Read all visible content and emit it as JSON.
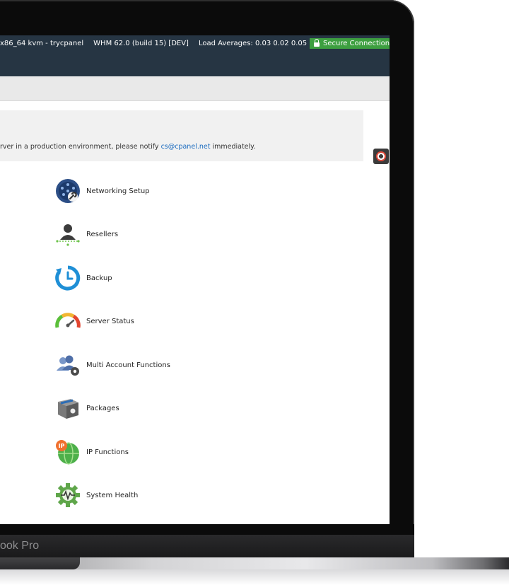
{
  "topbar": {
    "host": "x86_64 kvm - trycpanel",
    "version": "WHM 62.0 (build 15) [DEV]",
    "load": "Load Averages: 0.03 0.02 0.05",
    "secure": "Secure Connection"
  },
  "notice": {
    "prefix": "rver in a production environment, please notify ",
    "email": "cs@cpanel.net",
    "suffix": " immediately."
  },
  "menu": {
    "items": [
      {
        "label": "Networking Setup",
        "icon": "network-wrench-icon"
      },
      {
        "label": "Resellers",
        "icon": "reseller-person-icon"
      },
      {
        "label": "Backup",
        "icon": "backup-clock-icon"
      },
      {
        "label": "Server Status",
        "icon": "gauge-icon"
      },
      {
        "label": "Multi Account Functions",
        "icon": "multi-user-gear-icon"
      },
      {
        "label": "Packages",
        "icon": "package-box-icon"
      },
      {
        "label": "IP Functions",
        "icon": "ip-globe-icon"
      },
      {
        "label": "System Health",
        "icon": "health-gear-icon"
      }
    ]
  },
  "device": {
    "label": "ook Pro"
  },
  "colors": {
    "topbar": "#263543",
    "secure": "#3d9f40",
    "link": "#1a6bbf"
  }
}
